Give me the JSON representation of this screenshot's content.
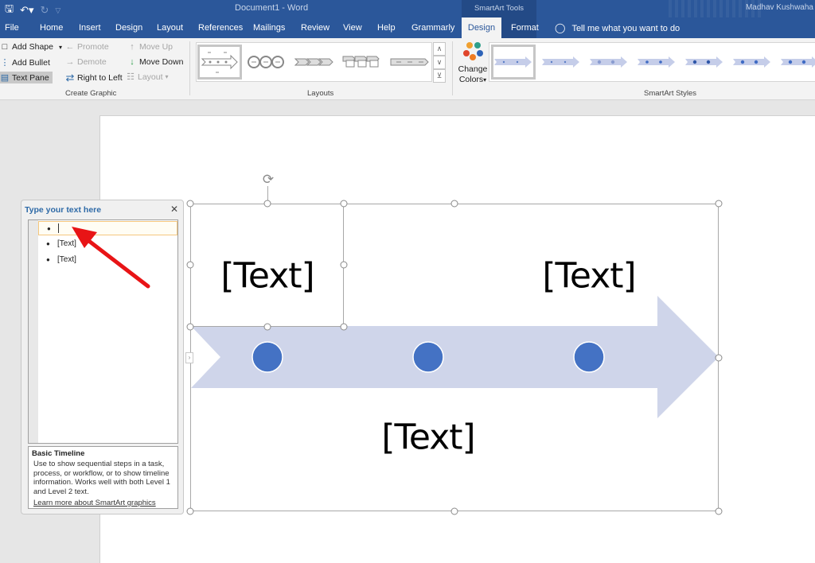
{
  "titlebar": {
    "doc_title": "Document1  -  Word",
    "context_title": "SmartArt Tools",
    "user_name": "Madhav Kushwaha",
    "qat": {
      "save_icon": "save-icon",
      "undo_icon": "undo-icon",
      "redo_icon": "redo-icon",
      "customize_icon": "customize-qat-icon"
    }
  },
  "tabs": [
    {
      "label": "File"
    },
    {
      "label": "Home"
    },
    {
      "label": "Insert"
    },
    {
      "label": "Design"
    },
    {
      "label": "Layout"
    },
    {
      "label": "References"
    },
    {
      "label": "Mailings"
    },
    {
      "label": "Review"
    },
    {
      "label": "View"
    },
    {
      "label": "Help"
    },
    {
      "label": "Grammarly"
    },
    {
      "label": "Design",
      "active": true
    },
    {
      "label": "Format"
    }
  ],
  "tell_me": "Tell me what you want to do",
  "ribbon": {
    "create_graphic": {
      "label": "Create Graphic",
      "add_shape": "Add Shape",
      "add_bullet": "Add Bullet",
      "text_pane": "Text Pane",
      "promote": "Promote",
      "demote": "Demote",
      "right_to_left": "Right to Left",
      "move_up": "Move Up",
      "move_down": "Move Down",
      "layout": "Layout"
    },
    "layouts": {
      "label": "Layouts",
      "items": [
        "Basic Timeline",
        "Circle Accent Timeline",
        "Chevron Process",
        "Closed Chevron Process",
        "Arrow Process"
      ],
      "selected_index": 0
    },
    "smartart_styles": {
      "label": "SmartArt Styles",
      "change_colors": "Change Colors",
      "color_dots": [
        "#f0a030",
        "#2e9f8a",
        "#e0452b",
        "#f07c22",
        "#2e63b8"
      ],
      "count": 7,
      "selected_index": 0
    }
  },
  "text_pane": {
    "title": "Type your text here",
    "items": [
      {
        "text": "",
        "active": true
      },
      {
        "text": "[Text]"
      },
      {
        "text": "[Text]"
      }
    ],
    "description_title": "Basic Timeline",
    "description": "Use to show sequential steps in a task, process, or workflow, or to show timeline information. Works well with both Level 1 and Level 2 text.",
    "learn_more": "Learn more about SmartArt graphics"
  },
  "smartart": {
    "texts": [
      "[Text]",
      "[Text]",
      "[Text]"
    ],
    "arrow_color": "#cfd5ea",
    "dot_color": "#4472c4"
  },
  "colors": {
    "brand": "#2b579a",
    "annotation": "#e81416"
  }
}
